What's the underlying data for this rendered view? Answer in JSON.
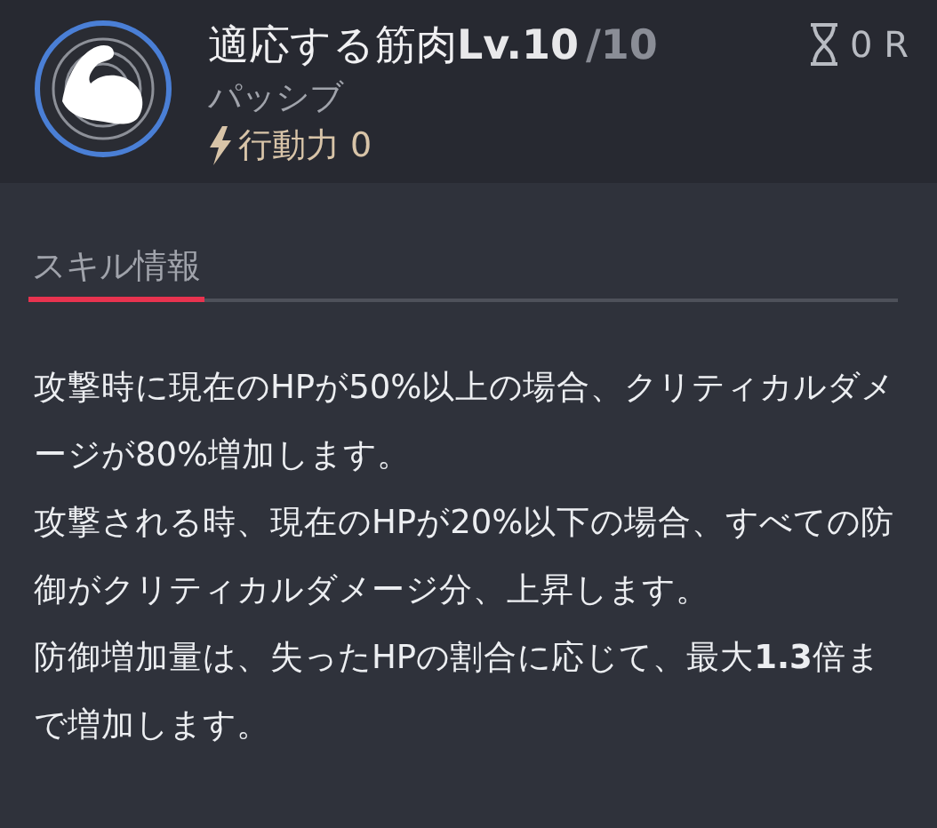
{
  "skill": {
    "title": "適応する筋肉**Lv.10**",
    "max_level": "/10",
    "type": "パッシブ",
    "action_cost": "行動力 0",
    "cooldown": "0 R"
  },
  "tabs": [
    {
      "label": "スキル情報",
      "selected": true
    }
  ],
  "description": [
    "攻撃時に現在のHPが50%以上の場合、クリティカルダメージが80%増加します。",
    "攻撃される時、現在のHPが20%以下の場合、すべての防御がクリティカルダメージ分、上昇します。",
    "防御増加量は、失ったHPの割合に応じて、最大**1.3**倍まで増加します。"
  ]
}
